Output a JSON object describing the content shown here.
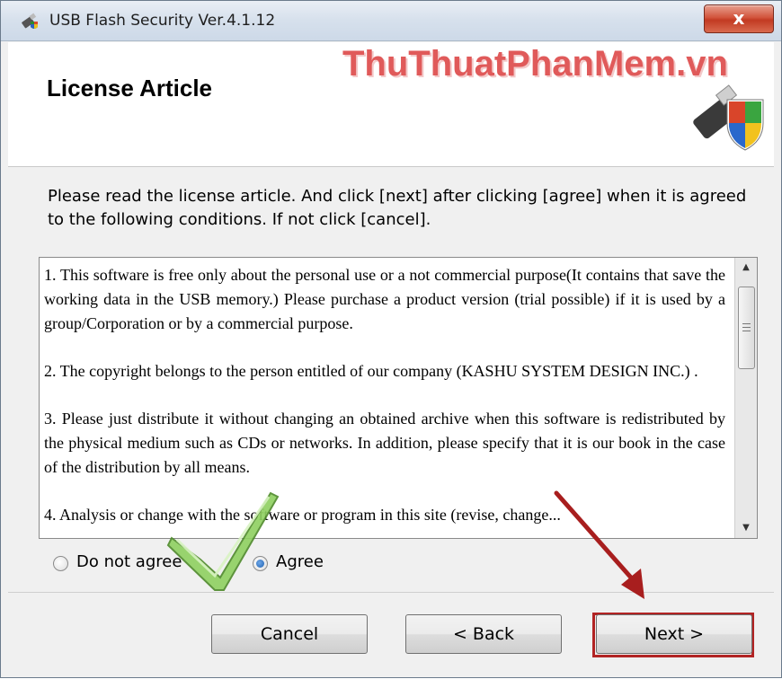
{
  "window": {
    "title": "USB Flash Security Ver.4.1.12",
    "close_label": "x"
  },
  "header": {
    "title": "License Article",
    "watermark": "ThuThuatPhanMem.vn"
  },
  "instructions": "Please read the license article. And click [next] after clicking [agree] when it is agreed to the following conditions. If not click [cancel].",
  "license": {
    "paragraphs": [
      "1. This software is free only about the personal use or a not commercial purpose(It contains that save the working data in the USB memory.) Please purchase a product version (trial possible) if it is used by a group/Corporation or by a commercial purpose.",
      "2. The copyright belongs to the person entitled of our company (KASHU SYSTEM DESIGN INC.) .",
      "3. Please just distribute it without changing an obtained archive when this software is redistributed by the physical medium such as CDs or networks.  In addition, please specify that it is our book in the case of the distribution by all means.",
      "4. Analysis or change with the software or program in this site (revise, change..."
    ]
  },
  "agreement": {
    "options": [
      {
        "label": "Do not agree",
        "selected": false
      },
      {
        "label": "Agree",
        "selected": true
      }
    ]
  },
  "buttons": {
    "cancel": "Cancel",
    "back": "< Back",
    "next": "Next >"
  },
  "colors": {
    "highlight": "#b22424",
    "watermark": "#e05a5a",
    "checkmark": "#7ec850"
  },
  "icons": {
    "app": "usb-shield-icon",
    "header": "usb-shield-icon",
    "scroll_up": "chevron-up-icon",
    "scroll_down": "chevron-down-icon",
    "annotation_check": "checkmark-icon",
    "annotation_arrow": "arrow-icon"
  }
}
